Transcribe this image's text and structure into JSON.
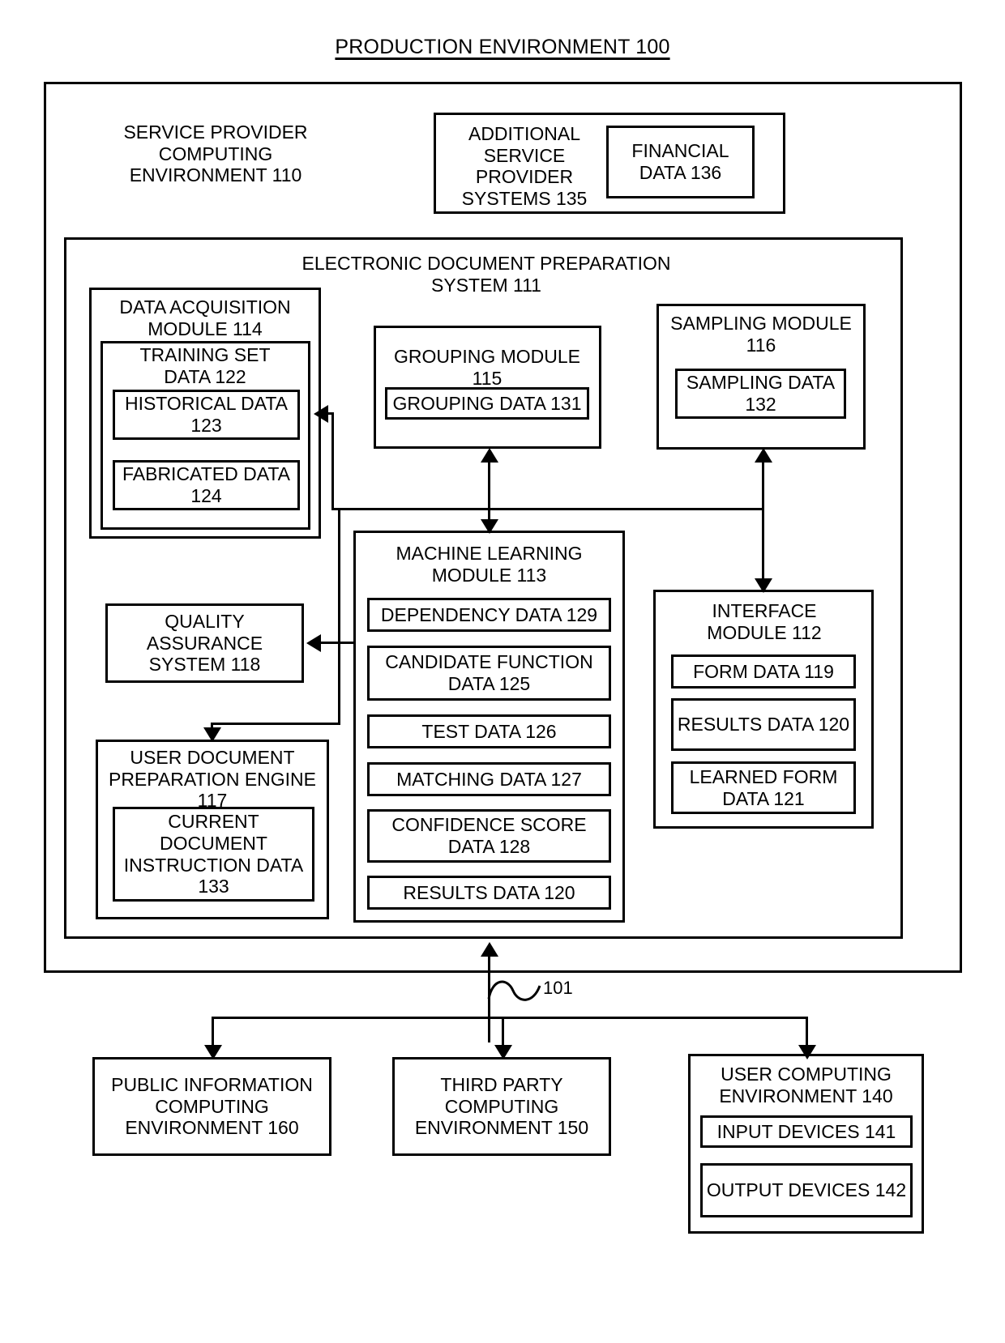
{
  "title": "PRODUCTION ENVIRONMENT 100",
  "service_provider": {
    "label": "SERVICE PROVIDER\nCOMPUTING\nENVIRONMENT 110"
  },
  "additional_service_provider": {
    "label": "ADDITIONAL\nSERVICE\nPROVIDER\nSYSTEMS 135",
    "financial_data": "FINANCIAL\nDATA\n136"
  },
  "edps": {
    "label": "ELECTRONIC DOCUMENT PREPARATION\nSYSTEM  111"
  },
  "data_acquisition": {
    "label": "DATA ACQUISITION\nMODULE 114",
    "training_set": {
      "label": "TRAINING SET\nDATA 122",
      "historical": "HISTORICAL DATA\n123",
      "fabricated": "FABRICATED DATA\n124"
    }
  },
  "grouping_module": {
    "label": "GROUPING MODULE 115",
    "grouping_data": "GROUPING DATA 131"
  },
  "sampling_module": {
    "label": "SAMPLING MODULE\n116",
    "sampling_data": "SAMPLING DATA\n132"
  },
  "machine_learning": {
    "label": "MACHINE LEARNING\nMODULE 113",
    "items": [
      "DEPENDENCY DATA 129",
      "CANDIDATE FUNCTION\nDATA 125",
      "TEST DATA 126",
      "MATCHING DATA 127",
      "CONFIDENCE SCORE\nDATA 128",
      "RESULTS DATA 120"
    ]
  },
  "interface_module": {
    "label": "INTERFACE\nMODULE 112",
    "items": [
      "FORM DATA 119",
      "RESULTS DATA\n120",
      "LEARNED FORM\nDATA 121"
    ]
  },
  "quality_assurance": {
    "label": "QUALITY\nASSURANCE\nSYSTEM 118"
  },
  "user_document_engine": {
    "label": "USER DOCUMENT\nPREPARATION  ENGINE\n117",
    "current_document": "CURRENT\nDOCUMENT\nINSTRUCTION DATA\n133"
  },
  "network": {
    "label": "101"
  },
  "public_information": {
    "label": "PUBLIC INFORMATION\nCOMPUTING\nENVIRONMENT 160"
  },
  "third_party": {
    "label": "THIRD PARTY\nCOMPUTING\nENVIRONMENT 150"
  },
  "user_computing": {
    "label": "USER COMPUTING\nENVIRONMENT 140",
    "input_devices": "INPUT DEVICES 141",
    "output_devices": "OUTPUT DEVICES\n142"
  }
}
